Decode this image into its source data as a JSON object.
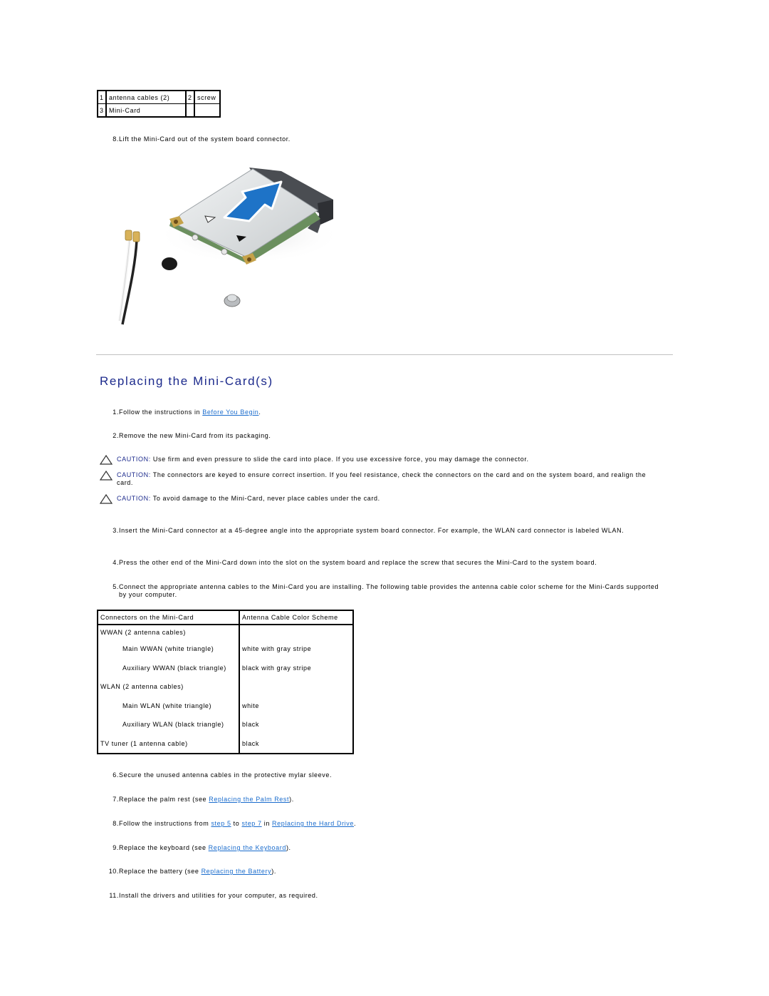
{
  "legend": {
    "rows": [
      [
        {
          "num": "1",
          "label": "antenna cables (2)"
        },
        {
          "num": "2",
          "label": "screw"
        }
      ],
      [
        {
          "num": "3",
          "label": "Mini-Card"
        },
        {
          "num": "",
          "label": ""
        }
      ]
    ]
  },
  "removal_step": {
    "num": "8.",
    "text": "Lift the Mini-Card out of the system board connector."
  },
  "figure": {
    "alt": "Mini-Card being lifted out of the system board connector with antenna cables and screw"
  },
  "section_title": "Replacing the Mini-Card(s)",
  "steps_a": [
    {
      "num": "1.",
      "pre": "Follow the instructions in ",
      "link": "Before You Begin",
      "post": "."
    },
    {
      "num": "2.",
      "text": "Remove the new Mini-Card from its packaging."
    }
  ],
  "cautions": [
    {
      "tag": "CAUTION:",
      "text": " Use firm and even pressure to slide the card into place. If you use excessive force, you may damage the connector."
    },
    {
      "tag": "CAUTION:",
      "text": " The connectors are keyed to ensure correct insertion. If you feel resistance, check the connectors on the card and on the system board, and realign the card."
    },
    {
      "tag": "CAUTION:",
      "text": " To avoid damage to the Mini-Card, never place cables under the card."
    }
  ],
  "steps_b": [
    {
      "num": "3.",
      "text": "Insert the Mini-Card connector at a 45-degree angle into the appropriate system board connector. For example, the WLAN card connector is labeled WLAN."
    },
    {
      "num": "4.",
      "text": "Press the other end of the Mini-Card down into the slot on the system board and replace the screw that secures the Mini-Card to the system board."
    },
    {
      "num": "5.",
      "text": "Connect the appropriate antenna cables to the Mini-Card you are installing. The following table provides the antenna cable color scheme for the Mini-Cards supported by your computer."
    }
  ],
  "cable_table": {
    "headers": [
      "Connectors on the Mini-Card",
      "Antenna Cable Color Scheme"
    ],
    "rows": [
      {
        "connector": "WWAN (2 antenna cables)",
        "color": "",
        "sub": false
      },
      {
        "connector": "Main WWAN (white triangle)",
        "color": "white with gray stripe",
        "sub": true
      },
      {
        "connector": "Auxiliary WWAN (black triangle)",
        "color": "black with gray stripe",
        "sub": true
      },
      {
        "connector": "WLAN (2 antenna cables)",
        "color": "",
        "sub": false
      },
      {
        "connector": "Main WLAN (white triangle)",
        "color": "white",
        "sub": true
      },
      {
        "connector": "Auxiliary WLAN (black triangle)",
        "color": "black",
        "sub": true
      },
      {
        "connector": "TV tuner (1 antenna cable)",
        "color": "black",
        "sub": false
      }
    ]
  },
  "steps_c": [
    {
      "num": "6.",
      "parts": [
        {
          "t": "Secure the unused antenna cables in the protective mylar sleeve."
        }
      ]
    },
    {
      "num": "7.",
      "parts": [
        {
          "t": "Replace the palm rest (see "
        },
        {
          "link": "Replacing the Palm Rest"
        },
        {
          "t": ")."
        }
      ]
    },
    {
      "num": "8.",
      "parts": [
        {
          "t": "Follow the instructions from "
        },
        {
          "link": "step 5"
        },
        {
          "t": " to "
        },
        {
          "link": "step 7"
        },
        {
          "t": " in "
        },
        {
          "link": "Replacing the Hard Drive"
        },
        {
          "t": "."
        }
      ]
    },
    {
      "num": "9.",
      "parts": [
        {
          "t": "Replace the keyboard (see "
        },
        {
          "link": "Replacing the Keyboard"
        },
        {
          "t": ")."
        }
      ]
    },
    {
      "num": "10.",
      "parts": [
        {
          "t": "Replace the battery (see "
        },
        {
          "link": "Replacing the Battery"
        },
        {
          "t": ")."
        }
      ]
    },
    {
      "num": "11.",
      "parts": [
        {
          "t": "Install the drivers and utilities for your computer, as required."
        }
      ]
    }
  ],
  "colors": {
    "title": "#1c2a8c",
    "link": "#1a6ccd",
    "caution_tag": "#1c2a8c",
    "rule": "#c0c0c0"
  }
}
